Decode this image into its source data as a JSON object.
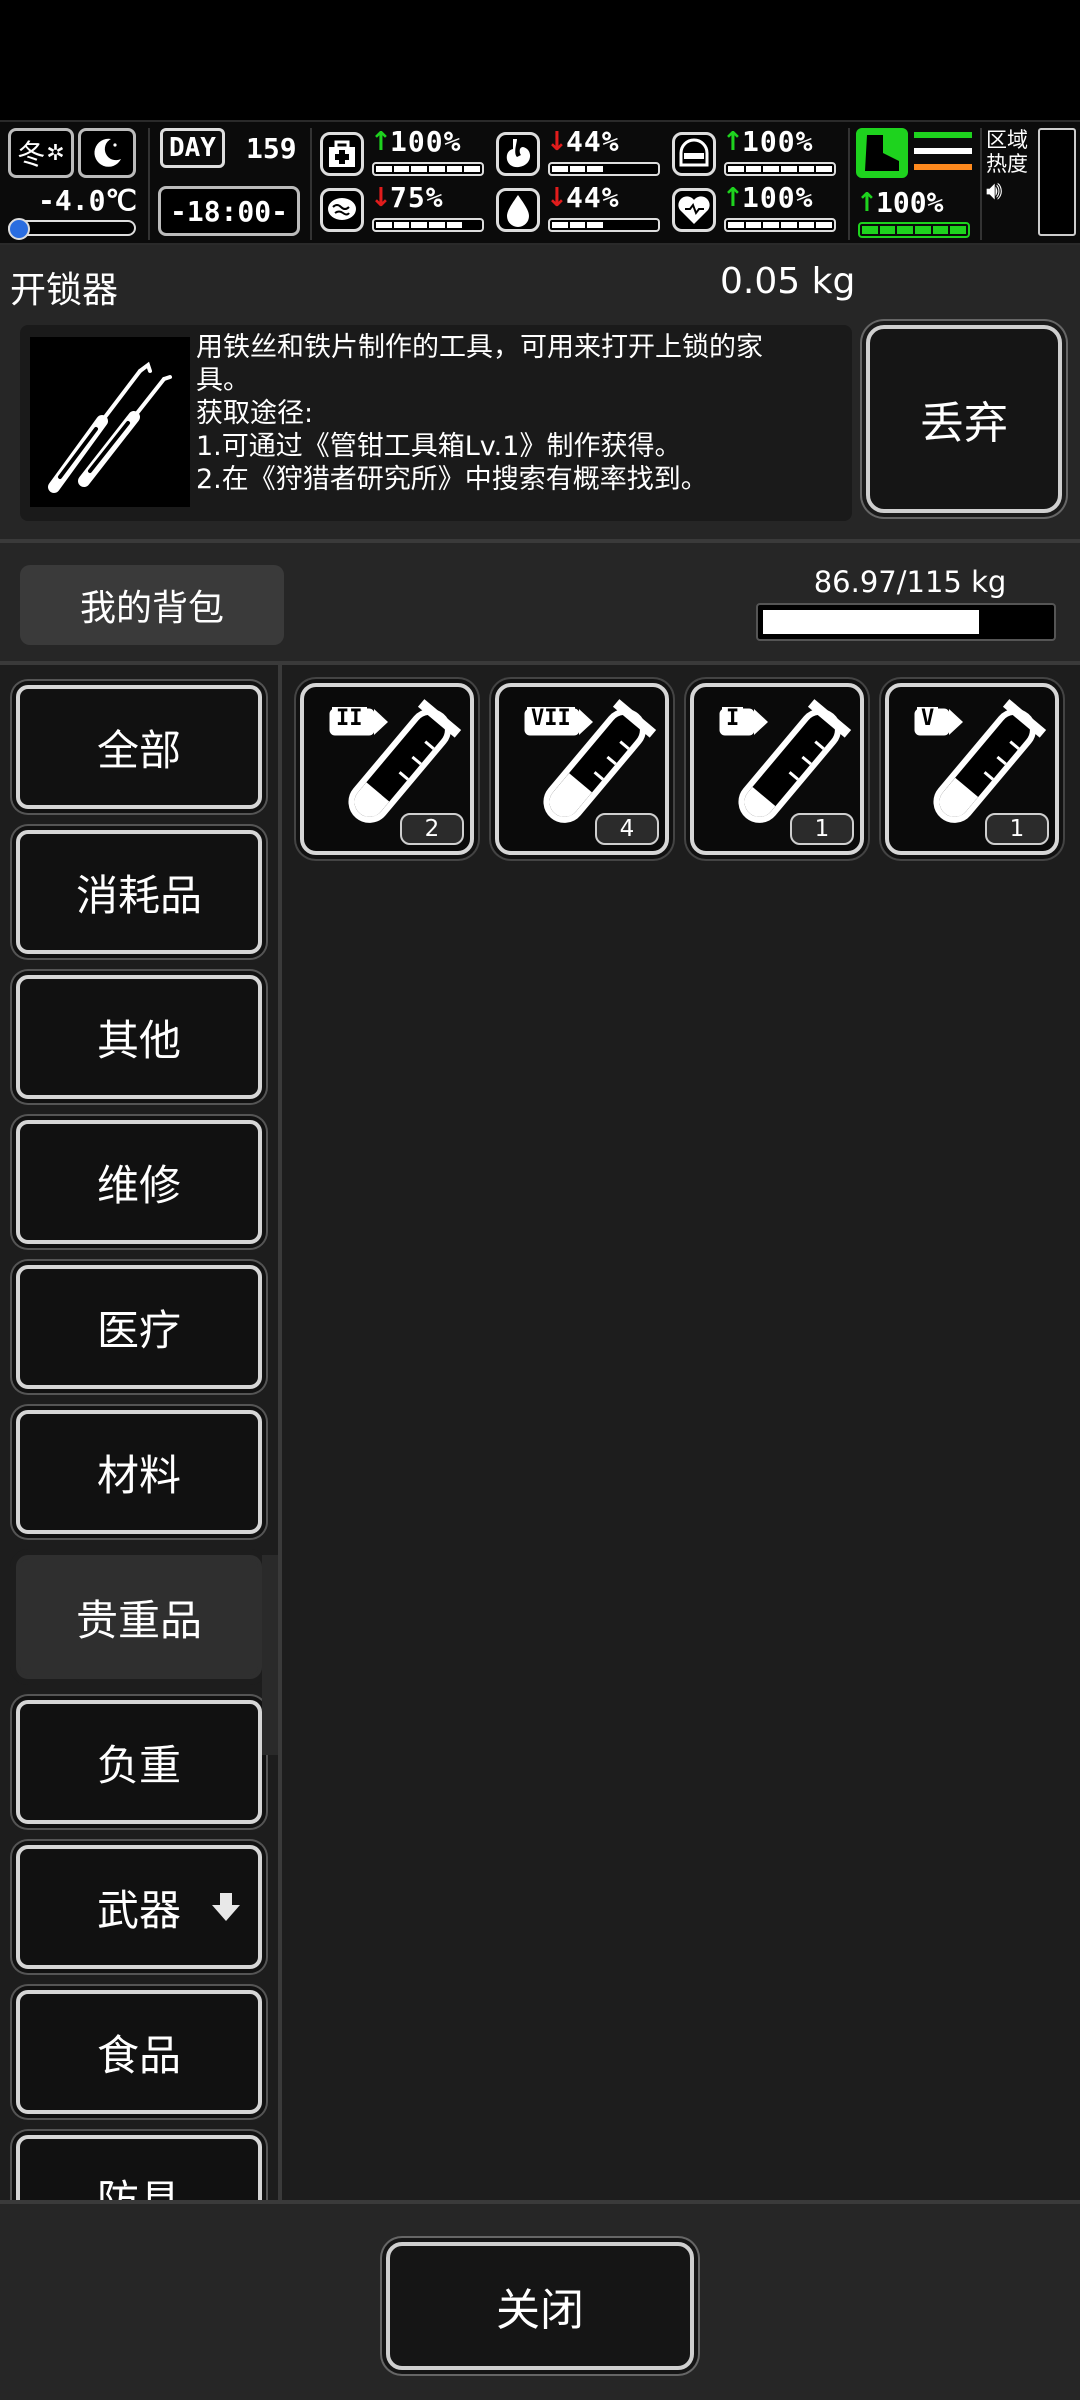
{
  "hud": {
    "season": "冬",
    "temperature": "-4.0℃",
    "day_label": "DAY",
    "day": "159",
    "time": "-18:00-",
    "stats": [
      {
        "name": "health",
        "icon": "medkit-icon",
        "trend": "up",
        "value": "100%",
        "level": 1.0
      },
      {
        "name": "hunger",
        "icon": "stomach-icon",
        "trend": "down",
        "value": "44%",
        "level": 0.44
      },
      {
        "name": "armor",
        "icon": "helmet-icon",
        "trend": "up",
        "value": "100%",
        "level": 1.0
      },
      {
        "name": "mood",
        "icon": "brain-icon",
        "trend": "down",
        "value": "75%",
        "level": 0.75
      },
      {
        "name": "thirst",
        "icon": "water-drop-icon",
        "trend": "down",
        "value": "44%",
        "level": 0.44
      },
      {
        "name": "heart",
        "icon": "heart-icon",
        "trend": "up",
        "value": "100%",
        "level": 1.0
      }
    ],
    "stamina": {
      "icon": "boot-icon",
      "trend": "up",
      "value": "100%",
      "level": 1.0
    },
    "zone_heat_label": [
      "区域",
      "热度"
    ]
  },
  "item": {
    "name": "开锁器",
    "weight": "0.05 kg",
    "description_lines": [
      "用铁丝和铁片制作的工具，可用来打开上锁的家",
      "具。",
      "获取途径:",
      "1.可通过《管钳工具箱Lv.1》制作获得。",
      "2.在《狩猎者研究所》中搜索有概率找到。"
    ],
    "discard_label": "丢弃"
  },
  "bag": {
    "title": "我的背包",
    "weight_text": "86.97/115 kg",
    "load": 0.756
  },
  "categories": [
    {
      "label": "全部",
      "active": false
    },
    {
      "label": "消耗品",
      "active": false
    },
    {
      "label": "其他",
      "active": false
    },
    {
      "label": "维修",
      "active": false
    },
    {
      "label": "医疗",
      "active": false
    },
    {
      "label": "材料",
      "active": false
    },
    {
      "label": "贵重品",
      "active": true
    },
    {
      "label": "负重",
      "active": false
    },
    {
      "label": "武器",
      "active": false,
      "badge": "arrow-down-icon"
    },
    {
      "label": "食品",
      "active": false
    },
    {
      "label": "防具",
      "active": false
    }
  ],
  "slots": [
    {
      "tier": "II",
      "count": "2",
      "fill": 0.35
    },
    {
      "tier": "VII",
      "count": "4",
      "fill": 0.55
    },
    {
      "tier": "I",
      "count": "1",
      "fill": 0.25
    },
    {
      "tier": "V",
      "count": "1",
      "fill": 0.45
    }
  ],
  "footer": {
    "close_label": "关闭"
  }
}
